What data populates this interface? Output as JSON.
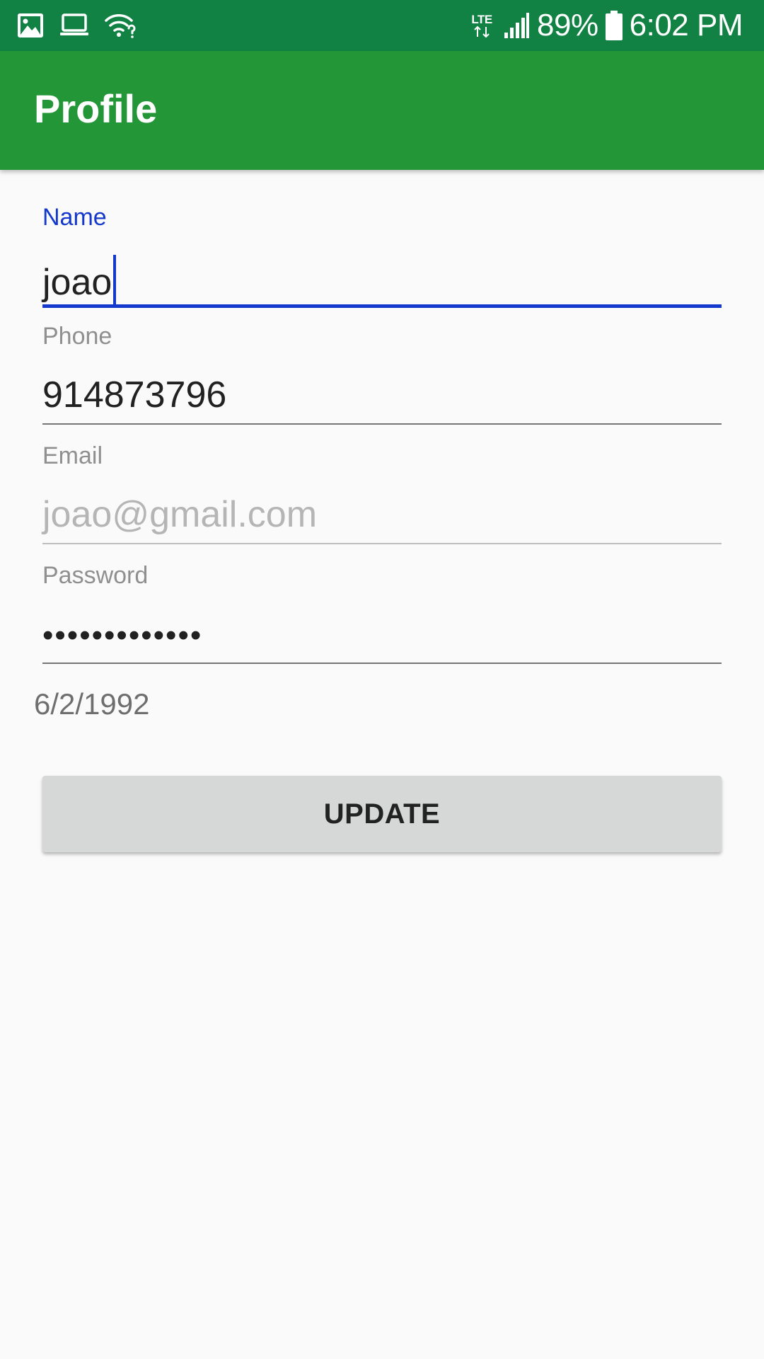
{
  "status_bar": {
    "network_type": "LTE",
    "battery_percent": "89%",
    "time": "6:02 PM",
    "left_icons": [
      "image-icon",
      "laptop-icon",
      "wifi-question-icon"
    ],
    "right_icons": [
      "lte-icon",
      "signal-icon",
      "battery-icon"
    ],
    "background_color": "#118244"
  },
  "app_bar": {
    "title": "Profile",
    "background_color": "#239637"
  },
  "form": {
    "name": {
      "label": "Name",
      "value": "joao",
      "focused": true
    },
    "phone": {
      "label": "Phone",
      "value": "914873796"
    },
    "email": {
      "label": "Email",
      "value": "joao@gmail.com",
      "enabled": false
    },
    "password": {
      "label": "Password",
      "value": "•••••••••••••"
    },
    "birth_date": "6/2/1992",
    "update_label": "UPDATE"
  },
  "colors": {
    "accent": "#1438cc",
    "background": "#fafafa",
    "button": "#d6d7d7"
  }
}
